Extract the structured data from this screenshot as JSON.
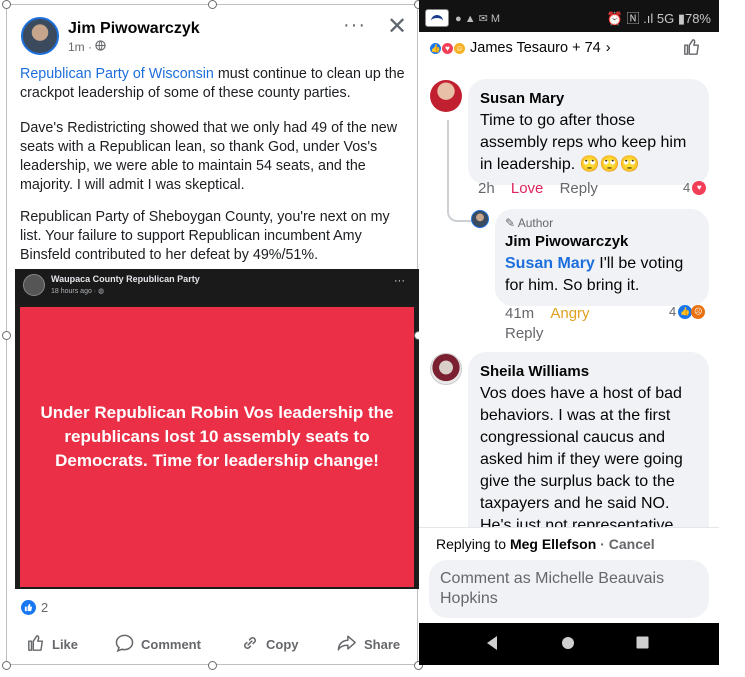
{
  "post": {
    "author": "Jim Piwowarczyk",
    "time": "1m",
    "dots": "···",
    "close": "✕",
    "p1_link": "Republican Party of Wisconsin",
    "p1_rest": " must continue to clean up the crackpot leadership of some of these county parties.",
    "p2": "Dave's Redistricting showed that we only had 49 of the new seats with a Republican lean, so thank God, under Vos's leadership, we were able to maintain 54 seats, and the majority.  I will admit I was skeptical.",
    "p3": "Republican Party of Sheboygan County, you're next on my list. Your failure to support Republican incumbent Amy Binsfeld contributed to her defeat by 49%/51%.",
    "shared": {
      "page_name": "Waupaca County Republican Party",
      "time": "18 hours ago · ",
      "dots": "···",
      "message": "Under Republican Robin Vos leadership the republicans lost 10 assembly seats to Democrats. Time for leadership change!"
    },
    "reaction_count": "2",
    "actions": {
      "like": "Like",
      "comment": "Comment",
      "copy": "Copy",
      "share": "Share"
    }
  },
  "phone": {
    "status_right": "⏰ 🄽 .ıl 5G ▮78%",
    "reacters": "James Tesauro + 74",
    "comments": [
      {
        "name": "Susan Mary",
        "text": "Time to go after those assembly reps who keep him in leadership. 🙄🙄🙄",
        "time": "2h",
        "reaction_label": "Love",
        "reply": "Reply",
        "count": "4"
      },
      {
        "badge": "Author",
        "name": "Jim Piwowarczyk",
        "mention": "Susan Mary",
        "text": " I'll be voting for him. So bring it.",
        "time": "41m",
        "reaction_label": "Angry",
        "reply": "Reply",
        "count": "4"
      },
      {
        "name": "Sheila Williams",
        "text": "Vos does have a host of bad behaviors.  I was at the first congressional caucus and asked him if they were going give the surplus back to the taxpayers and he said NO. He's just not representative"
      }
    ],
    "replying_prefix": "Replying to ",
    "replying_name": "Meg Ellefson",
    "replying_sep": " · ",
    "cancel": "Cancel",
    "composer_placeholder": "Comment as Michelle Beauvais Hopkins"
  },
  "colors": {
    "link": "#1d6fdc",
    "shared_bg": "#ea2f47",
    "love": "#e0245e",
    "angry": "#e0a020"
  }
}
